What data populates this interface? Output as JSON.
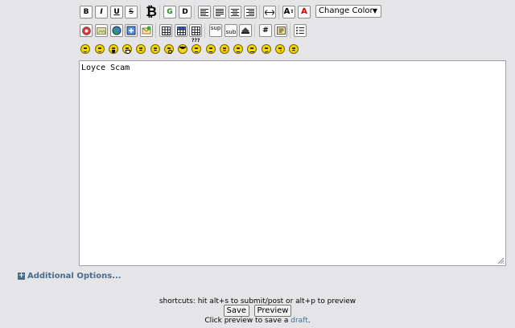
{
  "toolbar": {
    "bold": "B",
    "italic": "I",
    "underline": "U",
    "strike": "S",
    "bitcoin": "₿",
    "glow": "G",
    "shadow": "D",
    "size": "A",
    "font_color": "A",
    "sup": "sup",
    "sub": "sub",
    "hash": "#",
    "color_select": "Change Color"
  },
  "editor": {
    "value": "Loyce Scam"
  },
  "additional_options": "Additional Options...",
  "shortcuts": "shortcuts: hit alt+s to submit/post or alt+p to preview",
  "buttons": {
    "save": "Save",
    "preview": "Preview"
  },
  "draft": {
    "prefix": "Click preview to save a ",
    "link": "draft",
    "suffix": "."
  },
  "colors": {
    "accent": "#476c8e",
    "smiley": "#f3d700"
  }
}
